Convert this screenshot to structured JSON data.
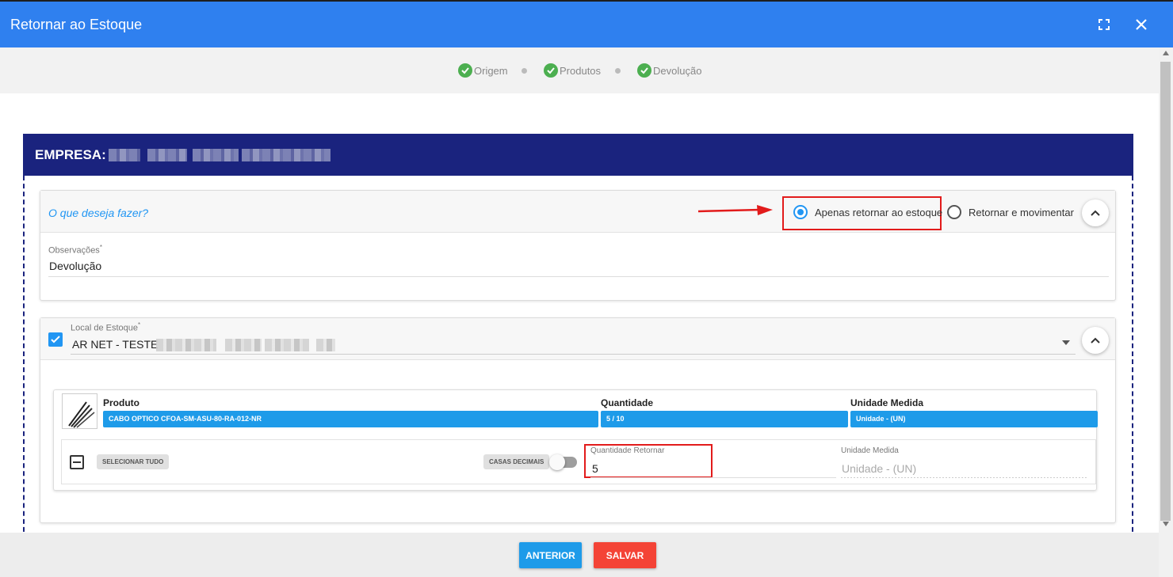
{
  "window": {
    "title": "Retornar ao Estoque",
    "maximize_icon": "expand-icon",
    "close_icon": "close-icon"
  },
  "stepper": {
    "steps": [
      {
        "label": "Origem",
        "status": "done"
      },
      {
        "label": "Produtos",
        "status": "done"
      },
      {
        "label": "Devolução",
        "status": "done"
      }
    ]
  },
  "company": {
    "label": "EMPRESA:"
  },
  "action": {
    "question": "O que deseja fazer?",
    "options": [
      {
        "label": "Apenas retornar ao estoque",
        "selected": true
      },
      {
        "label": "Retornar e movimentar",
        "selected": false
      }
    ]
  },
  "observacoes": {
    "label": "Observações",
    "required_mark": "*",
    "value": "Devolução"
  },
  "local_estoque": {
    "label": "Local de Estoque",
    "required_mark": "*",
    "value": "AR NET - TESTE",
    "checked": true
  },
  "product": {
    "headers": {
      "produto": "Produto",
      "quantidade": "Quantidade",
      "unidade": "Unidade Medida"
    },
    "name": "CABO OPTICO CFOA-SM-ASU-80-RA-012-NR",
    "quantity": "5 / 10",
    "unit": "Unidade - (UN)",
    "select_all": "SELECIONAR TUDO",
    "decimal_toggle": "CASAS DECIMAIS",
    "return_qty": {
      "label": "Quantidade Retornar",
      "value": "5"
    },
    "unit_field": {
      "label": "Unidade Medida",
      "value": "Unidade - (UN)"
    }
  },
  "footer": {
    "prev_label": "ANTERIOR",
    "save_label": "SALVAR"
  },
  "colors": {
    "header": "#2f80ef",
    "company_bar": "#1a237e",
    "chip": "#1e9be9",
    "prev_btn": "#1e9be9",
    "save_btn": "#f44336",
    "highlight": "#e21b1b"
  }
}
